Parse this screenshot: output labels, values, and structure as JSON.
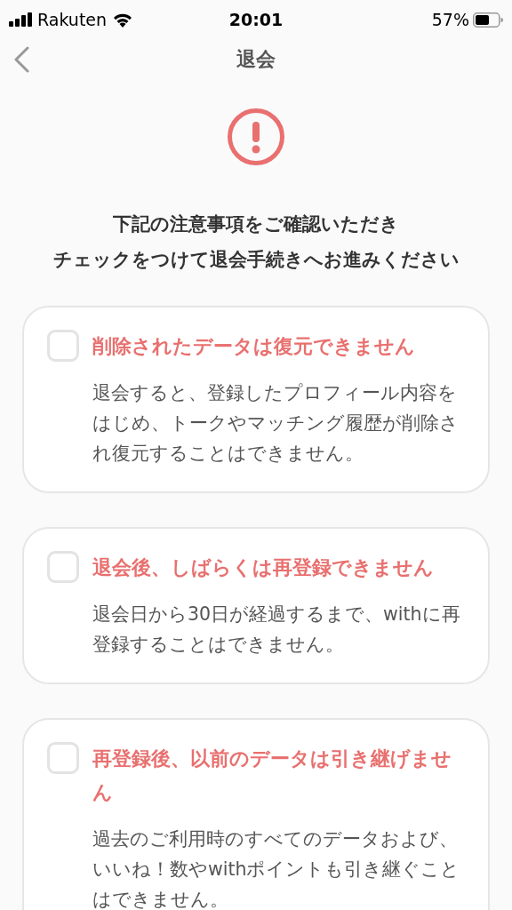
{
  "status_bar": {
    "carrier": "Rakuten",
    "time": "20:01",
    "battery": "57%"
  },
  "nav": {
    "title": "退会"
  },
  "heading_lines": [
    "下記の注意事項をご確認いただき",
    "チェックをつけて退会手続きへお進みください"
  ],
  "notices": [
    {
      "title": "削除されたデータは復元できません",
      "body": "退会すると、登録したプロフィール内容をはじめ、トークやマッチング履歴が削除され復元することはできません。",
      "checked": false
    },
    {
      "title": "退会後、しばらくは再登録できません",
      "body": "退会日から30日が経過するまで、withに再登録することはできません。",
      "checked": false
    },
    {
      "title": "再登録後、以前のデータは引き継げません",
      "body": "過去のご利用時のすべてのデータおよび、いいね！数やwithポイントも引き継ぐことはできません。",
      "checked": false
    }
  ]
}
